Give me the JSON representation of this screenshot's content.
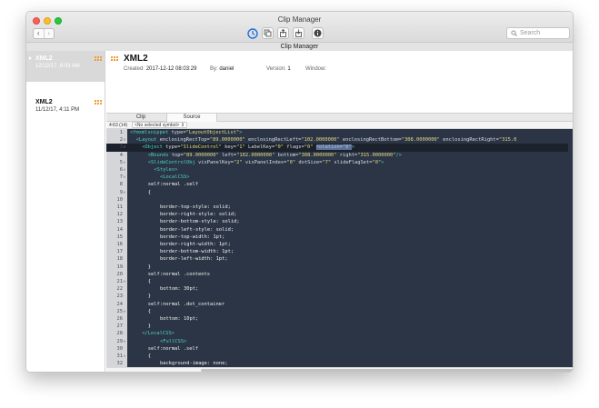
{
  "window": {
    "title": "Clip Manager",
    "tab_title": "Clip Manager"
  },
  "toolbar": {
    "back": "‹",
    "forward": "›",
    "search_placeholder": "Search"
  },
  "clips": [
    {
      "name": "XML2",
      "date": "12/12/17, 8:03 AM"
    },
    {
      "name": "XML2",
      "date": "11/12/17, 4:11 PM"
    }
  ],
  "detail": {
    "title": "XML2",
    "created_label": "Created:",
    "created_value": "2017-12-12 08:03:29",
    "by_label": "By:",
    "by_value": "daniel",
    "version_label": "Version:",
    "version_value": "1",
    "window_label": "Window:",
    "window_value": ""
  },
  "tabs": [
    "Clip",
    "Source"
  ],
  "editor_info": {
    "position": "4:63 (14)",
    "symbol": "<No selected symbol> ⇕"
  },
  "code_lines": [
    {
      "n": "1",
      "fold": "◦",
      "indent": 0,
      "parts": [
        {
          "c": "tag",
          "t": "<fmxmlsnippet "
        },
        {
          "c": "attr",
          "t": "type="
        },
        {
          "c": "str",
          "t": "\"LayoutObjectList\""
        },
        {
          "c": "tag",
          "t": ">"
        }
      ]
    },
    {
      "n": "2",
      "fold": "⊖",
      "indent": 2,
      "parts": [
        {
          "c": "tag",
          "t": "<Layout "
        },
        {
          "c": "attr",
          "t": "enclosingRectTop="
        },
        {
          "c": "str",
          "t": "\"89.0000000\""
        },
        {
          "c": "attr",
          "t": " enclosingRectLeft="
        },
        {
          "c": "str",
          "t": "\"102.0000000\""
        },
        {
          "c": "attr",
          "t": " enclosingRectBottom="
        },
        {
          "c": "str",
          "t": "\"308.0000000\""
        },
        {
          "c": "attr",
          "t": " enclosingRectRight="
        },
        {
          "c": "str",
          "t": "\"315.0"
        }
      ]
    },
    {
      "n": "3",
      "fold": "⊖",
      "indent": 4,
      "current": true,
      "parts": [
        {
          "c": "tag",
          "t": "<Object "
        },
        {
          "c": "attr",
          "t": "type="
        },
        {
          "c": "str",
          "t": "\"SlideControl\""
        },
        {
          "c": "attr",
          "t": " key="
        },
        {
          "c": "str",
          "t": "\"1\""
        },
        {
          "c": "attr",
          "t": " LabelKey="
        },
        {
          "c": "str",
          "t": "\"0\""
        },
        {
          "c": "attr",
          "t": " flags="
        },
        {
          "c": "str",
          "t": "\"0\" "
        },
        {
          "c": "sel",
          "t": "rotation=\"0\""
        },
        {
          "c": "tag",
          "t": ">"
        }
      ]
    },
    {
      "n": "4",
      "fold": "◦",
      "indent": 6,
      "parts": [
        {
          "c": "tag",
          "t": "<Bounds "
        },
        {
          "c": "attr",
          "t": "top="
        },
        {
          "c": "str",
          "t": "\"89.0000000\""
        },
        {
          "c": "attr",
          "t": " left="
        },
        {
          "c": "str",
          "t": "\"102.0000000\""
        },
        {
          "c": "attr",
          "t": " bottom="
        },
        {
          "c": "str",
          "t": "\"308.0000000\""
        },
        {
          "c": "attr",
          "t": " right="
        },
        {
          "c": "str",
          "t": "\"315.0000000\""
        },
        {
          "c": "tag",
          "t": "/>"
        }
      ]
    },
    {
      "n": "5",
      "fold": "⊖",
      "indent": 6,
      "parts": [
        {
          "c": "tag",
          "t": "<SlideControlObj "
        },
        {
          "c": "attr",
          "t": "visPanelKey="
        },
        {
          "c": "str",
          "t": "\"2\""
        },
        {
          "c": "attr",
          "t": " visPanelIndex="
        },
        {
          "c": "str",
          "t": "\"0\""
        },
        {
          "c": "attr",
          "t": " dotSize="
        },
        {
          "c": "str",
          "t": "\"7\""
        },
        {
          "c": "attr",
          "t": " slideFlagSet="
        },
        {
          "c": "str",
          "t": "\"0\""
        },
        {
          "c": "tag",
          "t": ">"
        }
      ]
    },
    {
      "n": "6",
      "fold": "⊖",
      "indent": 8,
      "parts": [
        {
          "c": "tag",
          "t": "<Styles>"
        }
      ]
    },
    {
      "n": "7",
      "fold": "⊖",
      "indent": 10,
      "parts": [
        {
          "c": "tag",
          "t": "<LocalCSS>"
        }
      ]
    },
    {
      "n": "8",
      "fold": "",
      "indent": 6,
      "parts": [
        {
          "c": "txt",
          "t": "self:normal .self"
        }
      ]
    },
    {
      "n": "9",
      "fold": "⊖",
      "indent": 6,
      "parts": [
        {
          "c": "txt",
          "t": "{"
        }
      ]
    },
    {
      "n": "10",
      "fold": "",
      "indent": 6,
      "parts": [
        {
          "c": "txt",
          "t": ""
        }
      ]
    },
    {
      "n": "11",
      "fold": "",
      "indent": 10,
      "parts": [
        {
          "c": "txt",
          "t": "border-top-style: solid;"
        }
      ]
    },
    {
      "n": "12",
      "fold": "",
      "indent": 10,
      "parts": [
        {
          "c": "txt",
          "t": "border-right-style: solid;"
        }
      ]
    },
    {
      "n": "13",
      "fold": "",
      "indent": 10,
      "parts": [
        {
          "c": "txt",
          "t": "border-bottom-style: solid;"
        }
      ]
    },
    {
      "n": "14",
      "fold": "",
      "indent": 10,
      "parts": [
        {
          "c": "txt",
          "t": "border-left-style: solid;"
        }
      ]
    },
    {
      "n": "15",
      "fold": "",
      "indent": 10,
      "parts": [
        {
          "c": "txt",
          "t": "border-top-width: 1pt;"
        }
      ]
    },
    {
      "n": "16",
      "fold": "",
      "indent": 10,
      "parts": [
        {
          "c": "txt",
          "t": "border-right-width: 1pt;"
        }
      ]
    },
    {
      "n": "17",
      "fold": "",
      "indent": 10,
      "parts": [
        {
          "c": "txt",
          "t": "border-bottom-width: 1pt;"
        }
      ]
    },
    {
      "n": "18",
      "fold": "",
      "indent": 10,
      "parts": [
        {
          "c": "txt",
          "t": "border-left-width: 1pt;"
        }
      ]
    },
    {
      "n": "19",
      "fold": "◦",
      "indent": 6,
      "parts": [
        {
          "c": "txt",
          "t": "}"
        }
      ]
    },
    {
      "n": "20",
      "fold": "",
      "indent": 6,
      "parts": [
        {
          "c": "txt",
          "t": "self:normal .contents"
        }
      ]
    },
    {
      "n": "21",
      "fold": "⊖",
      "indent": 6,
      "parts": [
        {
          "c": "txt",
          "t": "{"
        }
      ]
    },
    {
      "n": "22",
      "fold": "",
      "indent": 10,
      "parts": [
        {
          "c": "txt",
          "t": "bottom: 30pt;"
        }
      ]
    },
    {
      "n": "23",
      "fold": "◦",
      "indent": 6,
      "parts": [
        {
          "c": "txt",
          "t": "}"
        }
      ]
    },
    {
      "n": "24",
      "fold": "",
      "indent": 6,
      "parts": [
        {
          "c": "txt",
          "t": "self:normal .dot_container"
        }
      ]
    },
    {
      "n": "25",
      "fold": "⊖",
      "indent": 6,
      "parts": [
        {
          "c": "txt",
          "t": "{"
        }
      ]
    },
    {
      "n": "26",
      "fold": "",
      "indent": 10,
      "parts": [
        {
          "c": "txt",
          "t": "bottom: 10pt;"
        }
      ]
    },
    {
      "n": "27",
      "fold": "◦",
      "indent": 6,
      "parts": [
        {
          "c": "txt",
          "t": "}"
        }
      ]
    },
    {
      "n": "28",
      "fold": "◦",
      "indent": 4,
      "parts": [
        {
          "c": "tag",
          "t": "</LocalCSS>"
        }
      ]
    },
    {
      "n": "29",
      "fold": "⊖",
      "indent": 10,
      "parts": [
        {
          "c": "tag",
          "t": "<FullCSS>"
        }
      ]
    },
    {
      "n": "30",
      "fold": "",
      "indent": 6,
      "parts": [
        {
          "c": "txt",
          "t": "self:normal .self"
        }
      ]
    },
    {
      "n": "31",
      "fold": "⊖",
      "indent": 6,
      "parts": [
        {
          "c": "txt",
          "t": "{"
        }
      ]
    },
    {
      "n": "32",
      "fold": "",
      "indent": 10,
      "parts": [
        {
          "c": "txt",
          "t": "background-image: none;"
        }
      ]
    }
  ]
}
